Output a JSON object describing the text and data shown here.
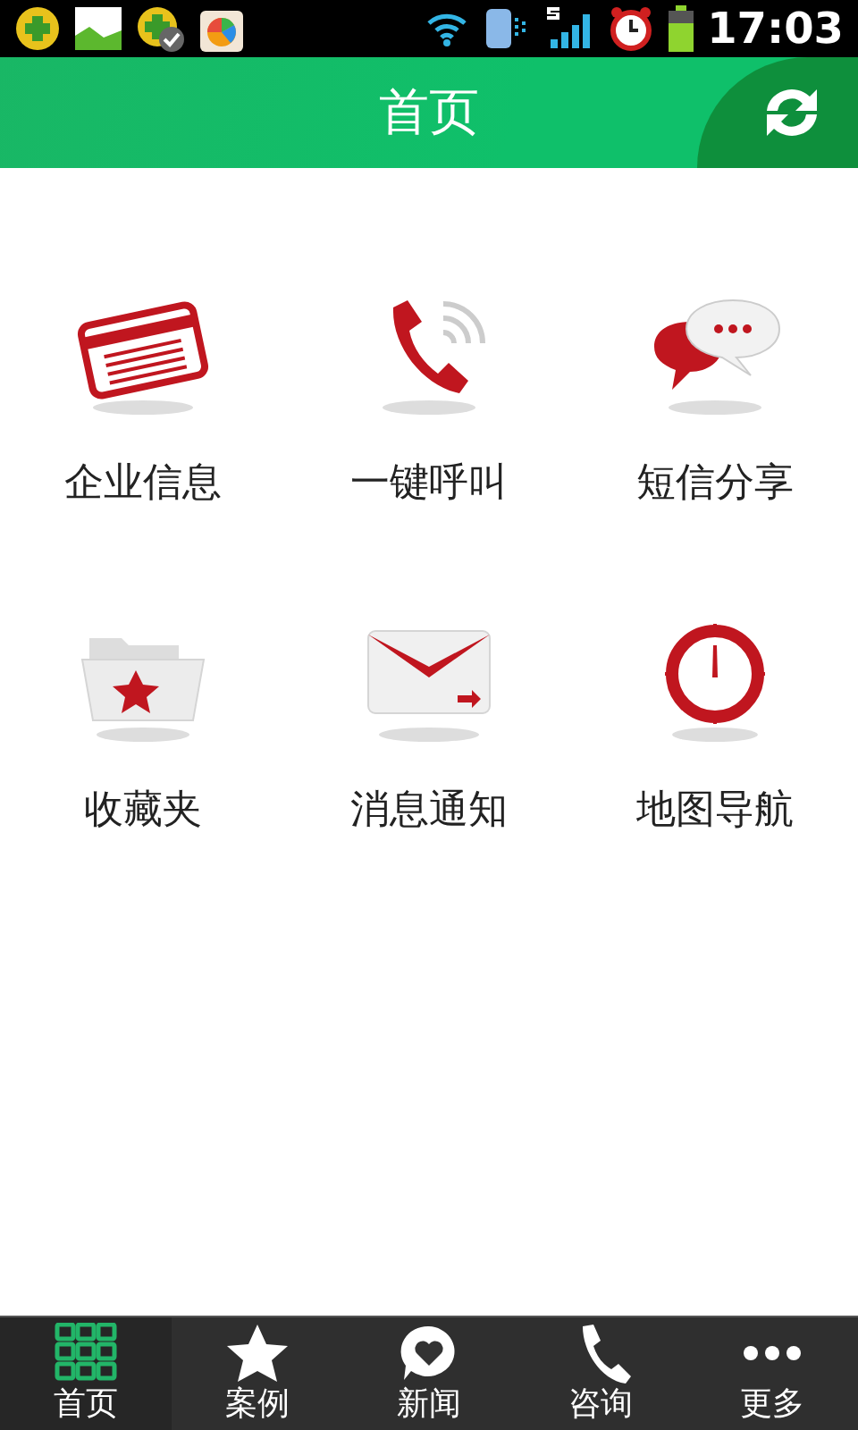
{
  "status_bar": {
    "time": "17:03"
  },
  "header": {
    "title": "首页"
  },
  "tiles": [
    {
      "kind": "card",
      "label": "企业信息"
    },
    {
      "kind": "phone",
      "label": "一键呼叫"
    },
    {
      "kind": "chat",
      "label": "短信分享"
    },
    {
      "kind": "folder",
      "label": "收藏夹"
    },
    {
      "kind": "mail",
      "label": "消息通知"
    },
    {
      "kind": "compass",
      "label": "地图导航"
    }
  ],
  "tabs": [
    {
      "kind": "grid",
      "label": "首页",
      "selected": true
    },
    {
      "kind": "star",
      "label": "案例",
      "selected": false
    },
    {
      "kind": "heart",
      "label": "新闻",
      "selected": false
    },
    {
      "kind": "phone",
      "label": "咨询",
      "selected": false
    },
    {
      "kind": "dots",
      "label": "更多",
      "selected": false
    }
  ]
}
